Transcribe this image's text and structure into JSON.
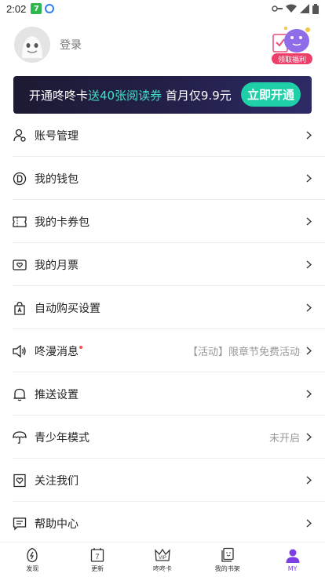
{
  "status_bar": {
    "time": "2:02",
    "app_badge": "7"
  },
  "profile": {
    "login_label": "登录",
    "welfare_label": "领取福利"
  },
  "banner": {
    "text_before": "开通咚咚卡",
    "text_highlight": "送40张阅读券",
    "text_after": " 首月仅9.9元",
    "button_label": "立即开通"
  },
  "menu": [
    {
      "label": "账号管理",
      "icon": "user-settings-icon",
      "value": ""
    },
    {
      "label": "我的钱包",
      "icon": "coin-icon",
      "value": ""
    },
    {
      "label": "我的卡券包",
      "icon": "ticket-icon",
      "value": ""
    },
    {
      "label": "我的月票",
      "icon": "heart-ticket-icon",
      "value": ""
    },
    {
      "label": "自动购买设置",
      "icon": "shopping-bag-icon",
      "value": ""
    },
    {
      "label": "咚漫消息",
      "icon": "speaker-icon",
      "value": "【活动】限章节免费活动",
      "dot": true
    },
    {
      "label": "推送设置",
      "icon": "bell-icon",
      "value": ""
    },
    {
      "label": "青少年模式",
      "icon": "umbrella-icon",
      "value": "未开启"
    },
    {
      "label": "关注我们",
      "icon": "heart-bookmark-icon",
      "value": ""
    },
    {
      "label": "帮助中心",
      "icon": "chat-icon",
      "value": ""
    }
  ],
  "tabbar": [
    {
      "label": "发现",
      "icon": "discover-icon"
    },
    {
      "label": "更新",
      "icon": "calendar-icon",
      "badge": "7"
    },
    {
      "label": "咚咚卡",
      "icon": "vip-crown-icon"
    },
    {
      "label": "我的书架",
      "icon": "bookshelf-icon"
    },
    {
      "label": "MY",
      "icon": "profile-icon",
      "active": true
    }
  ],
  "colors": {
    "accent": "#7b3fe4",
    "banner_highlight": "#3fe3c7",
    "banner_button": "#1fcfa7",
    "welfare_tag": "#ee3f6b"
  }
}
